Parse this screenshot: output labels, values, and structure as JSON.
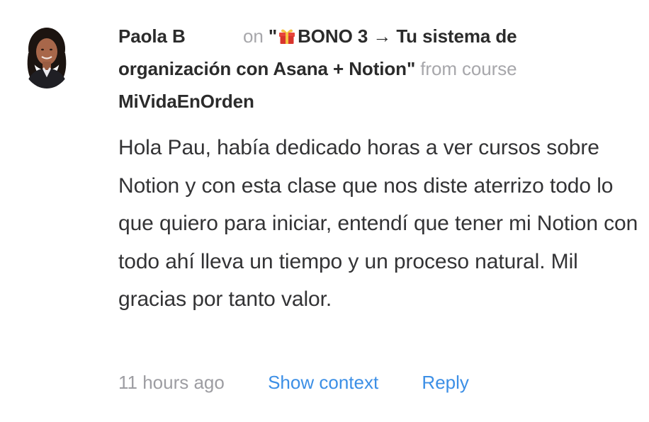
{
  "comment": {
    "author": "Paola B",
    "on_word": "on",
    "open_quote": "\"",
    "lesson_icon": "gift-icon",
    "lesson_title": "BONO 3 → Tu sistema de organización con Asana + Notion",
    "close_quote": "\"",
    "from_course_word": "from course",
    "course_name": "MiVidaEnOrden",
    "text": "Hola Pau, había dedicado horas a ver cursos sobre Notion y con esta clase que nos diste aterrizo todo lo que quiero para iniciar, entendí que tener mi Notion con todo ahí lleva un tiempo y un proceso natural. Mil gracias por tanto valor.",
    "timestamp": "11 hours ago",
    "show_context_label": "Show context",
    "reply_label": "Reply"
  },
  "colors": {
    "text_primary": "#2b2b2b",
    "text_muted": "#a7a7ab",
    "link": "#3c8fe6"
  }
}
